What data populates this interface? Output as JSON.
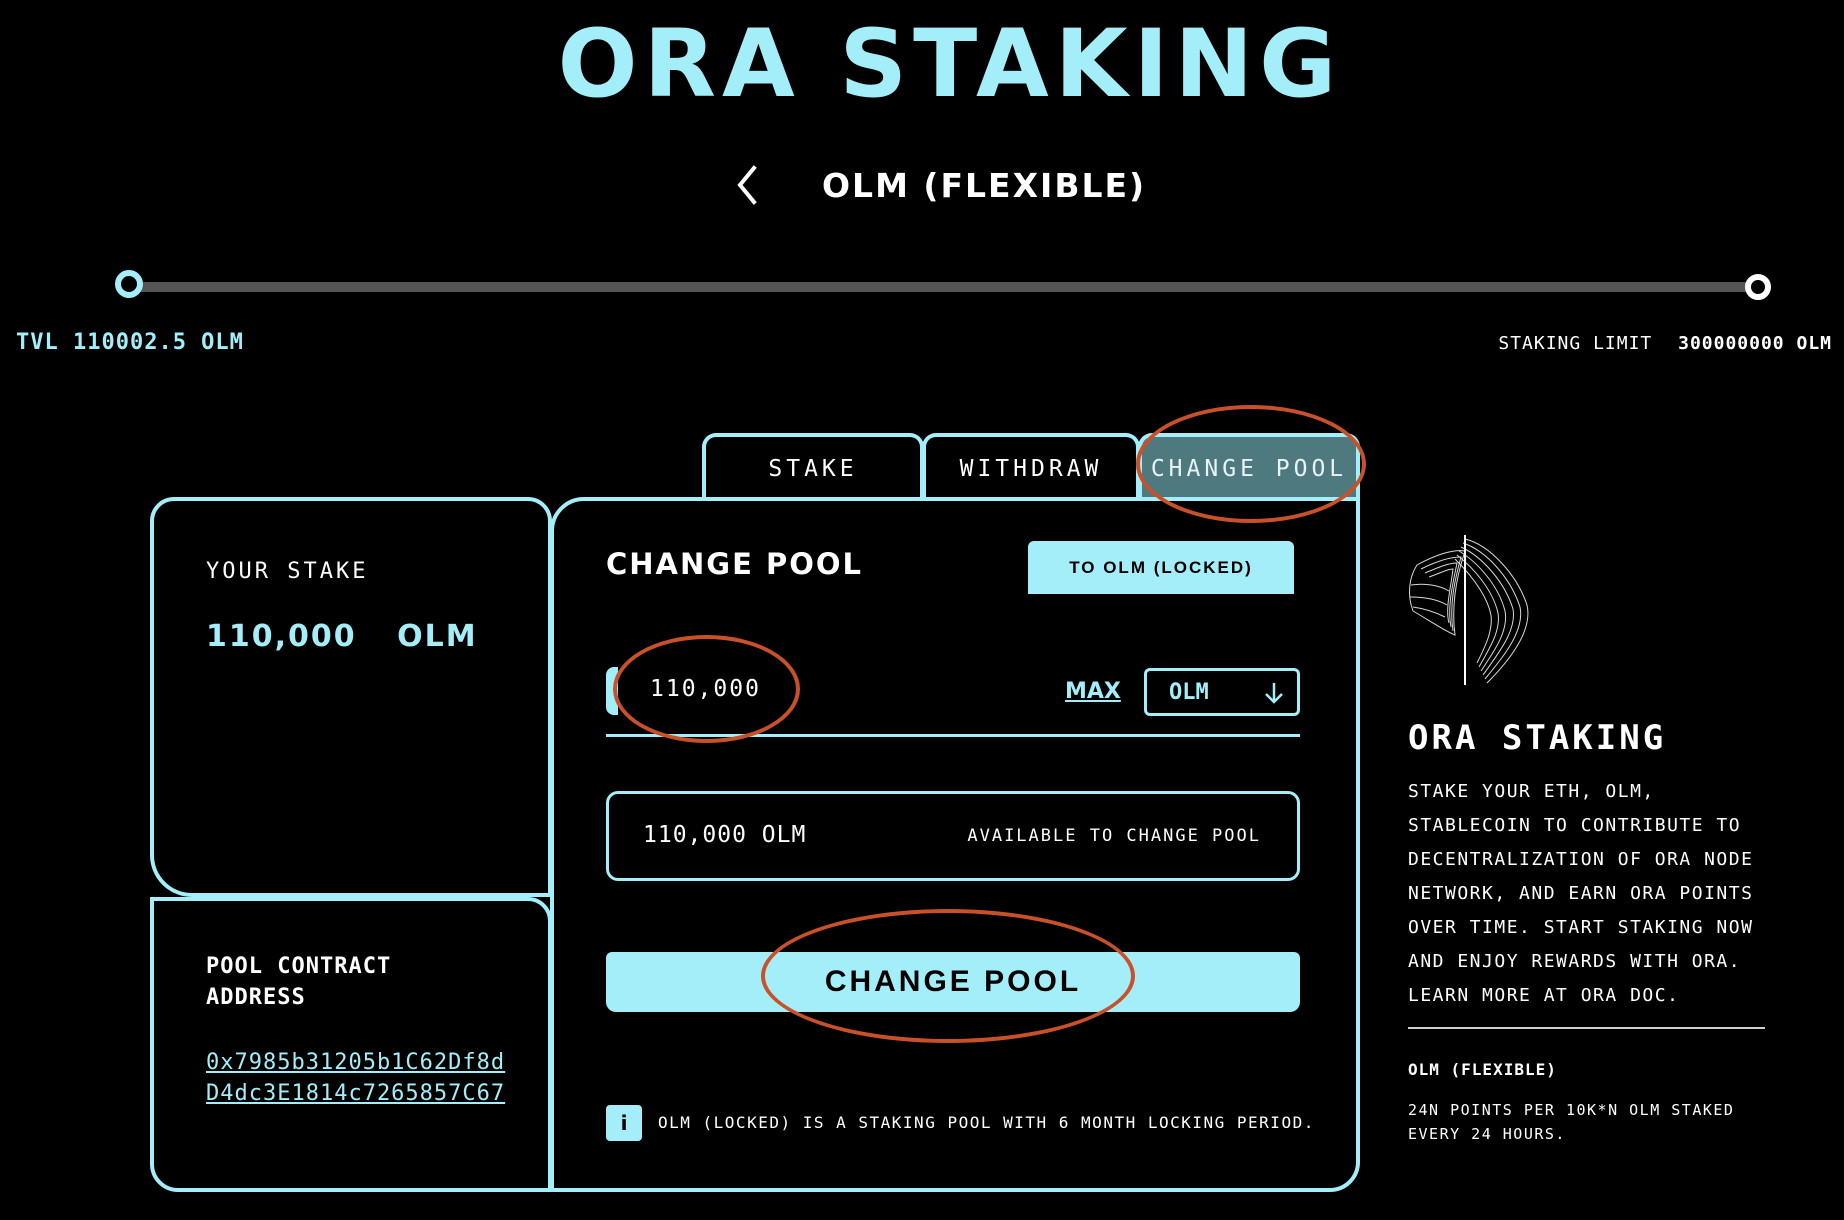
{
  "header": {
    "title": "ORA STAKING",
    "pool_name": "OLM (FLEXIBLE)"
  },
  "progress": {
    "tvl_label": "TVL 110002.5 OLM",
    "staking_limit_label": "STAKING LIMIT",
    "staking_limit_value": "300000000 OLM",
    "fill_fraction": 0.000367
  },
  "tabs": [
    {
      "label": "STAKE"
    },
    {
      "label": "WITHDRAW"
    },
    {
      "label": "CHANGE POOL"
    }
  ],
  "your_stake": {
    "label": "YOUR STAKE",
    "amount": "110,000",
    "token": "OLM"
  },
  "pool_contract": {
    "label": "POOL CONTRACT ADDRESS",
    "address": "0x7985b31205b1C62Df8dD4dc3E1814c7265857C67"
  },
  "change_pool": {
    "title": "CHANGE POOL",
    "target_button": "TO OLM (LOCKED)",
    "amount_value": "110,000",
    "max_label": "MAX",
    "token_selected": "OLM",
    "available_amount": "110,000 OLM",
    "available_label": "AVAILABLE TO CHANGE POOL",
    "action_button": "CHANGE POOL",
    "info_text": "OLM (LOCKED) IS A STAKING POOL WITH 6 MONTH LOCKING PERIOD."
  },
  "sidebar": {
    "title": "ORA STAKING",
    "description": "STAKE YOUR ETH, OLM, STABLECOIN TO CONTRIBUTE TO DECENTRALIZATION OF ORA NODE NETWORK, AND EARN ORA POINTS OVER TIME. START STAKING NOW AND ENJOY REWARDS WITH ORA.",
    "learn_more": "LEARN MORE AT ORA DOC.",
    "pool_name": "OLM (FLEXIBLE)",
    "points_text": "24N POINTS PER 10K*N OLM STAKED EVERY 24 HOURS."
  },
  "colors": {
    "accent": "#a3eef9",
    "active_tab": "#4e7a7f",
    "annotation": "#c8512a",
    "background": "#000000"
  }
}
